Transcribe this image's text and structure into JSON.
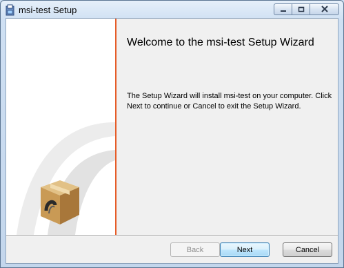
{
  "window": {
    "title": "msi-test Setup"
  },
  "title_buttons": {
    "minimize": "minimize-icon",
    "maximize": "maximize-icon",
    "close": "close-icon"
  },
  "wizard": {
    "heading": "Welcome to the msi-test Setup Wizard",
    "description": "The Setup Wizard will install msi-test on your computer. Click Next to continue or Cancel to exit the Setup Wizard."
  },
  "buttons": {
    "back": "Back",
    "next": "Next",
    "cancel": "Cancel"
  },
  "colors": {
    "accent_line": "#e65c28"
  }
}
